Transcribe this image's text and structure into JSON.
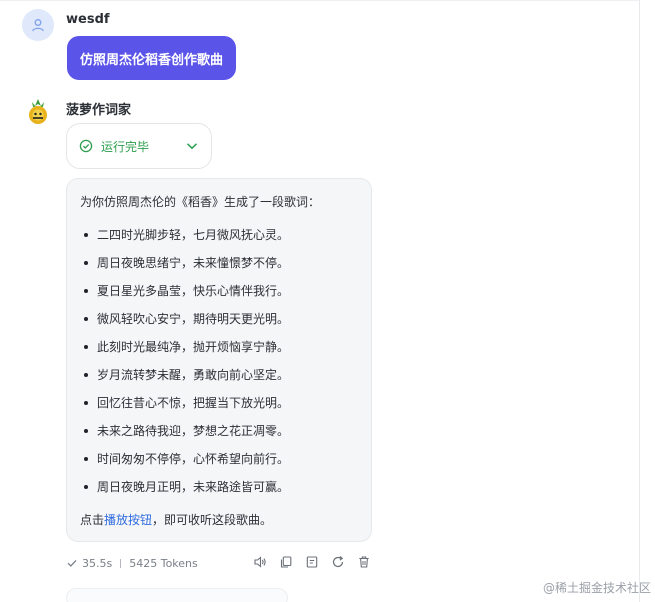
{
  "user": {
    "name": "wesdf",
    "message": "仿照周杰伦稻香创作歌曲"
  },
  "bot": {
    "name": "菠萝作词家",
    "status": "运行完毕",
    "intro": "为你仿照周杰伦的《稻香》生成了一段歌词：",
    "lyrics": [
      "二四时光脚步轻，七月微风抚心灵。",
      "周日夜晚思绪宁，未来憧憬梦不停。",
      "夏日星光多晶莹，快乐心情伴我行。",
      "微风轻吹心安宁，期待明天更光明。",
      "此刻时光最纯净，抛开烦恼享宁静。",
      "岁月流转梦未醒，勇敢向前心坚定。",
      "回忆往昔心不惊，把握当下放光明。",
      "未来之路待我迎，梦想之花正凋零。",
      "时间匆匆不停停，心怀希望向前行。",
      "周日夜晚月正明，未来路途皆可赢。"
    ],
    "outro_prefix": "点击",
    "outro_link": "播放按钮",
    "outro_suffix": "，即可收听这段歌曲。"
  },
  "meta": {
    "duration": "35.5s",
    "tokens": "5425 Tokens"
  },
  "icons": {
    "status": "check-circle-icon",
    "expand": "chevron-down-icon",
    "tools": [
      "speaker-icon",
      "copy-icon",
      "note-icon",
      "refresh-icon",
      "delete-icon"
    ]
  },
  "watermark": "@稀土掘金技术社区",
  "colors": {
    "accent": "#5b54e8",
    "success": "#2e9e4f",
    "link": "#2f6bde"
  }
}
